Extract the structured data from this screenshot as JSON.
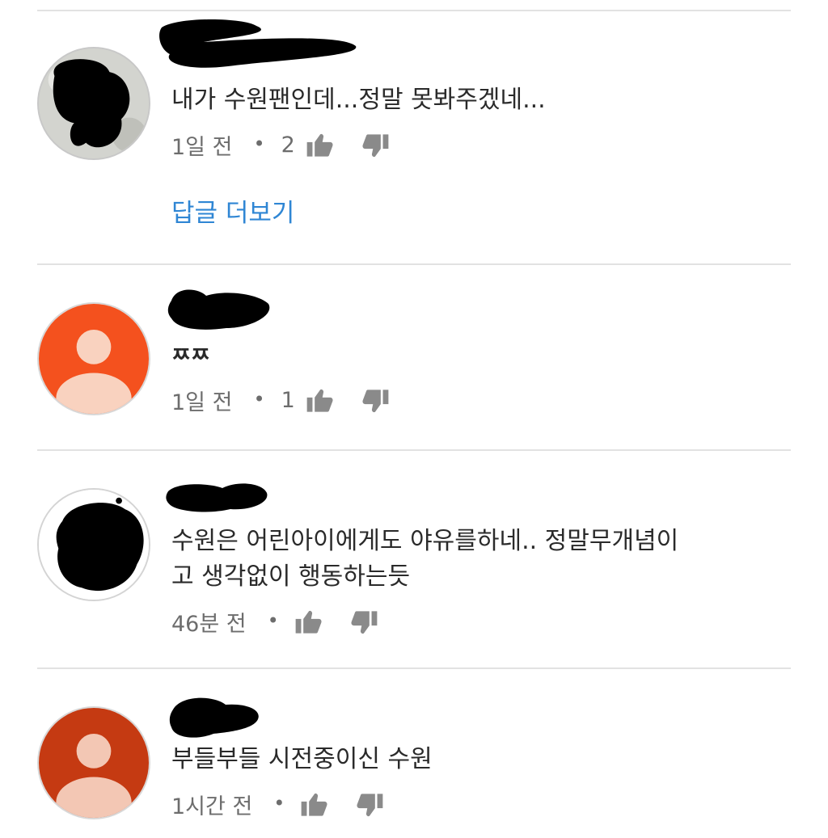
{
  "comments": [
    {
      "text": "내가 수원팬인데...정말 못봐주겠네...",
      "time": "1일 전",
      "dot": "•",
      "likes": "2",
      "view_replies": "답글 더보기",
      "avatar_icon": "redacted-avatar-icon"
    },
    {
      "text": "ㅉㅉ",
      "time": "1일 전",
      "dot": "•",
      "likes": "1",
      "avatar_icon": "default-user-avatar-icon",
      "avatar_color": "#f4511e"
    },
    {
      "text": "수원은 어린아이에게도 야유를하네.. 정말무개념이\n고 생각없이 행동하는듯",
      "time": "46분 전",
      "dot": "•",
      "likes": "",
      "avatar_icon": "redacted-avatar-icon"
    },
    {
      "text": "부들부들 시전중이신 수원",
      "time": "1시간 전",
      "dot": "•",
      "likes": "",
      "avatar_icon": "default-user-avatar-icon",
      "avatar_color": "#c53a12"
    }
  ],
  "colors": {
    "reply_link": "#2f86d4",
    "meta_text": "#6d6d6d",
    "divider": "#e2e2e2",
    "icon": "#8a8a8a"
  }
}
